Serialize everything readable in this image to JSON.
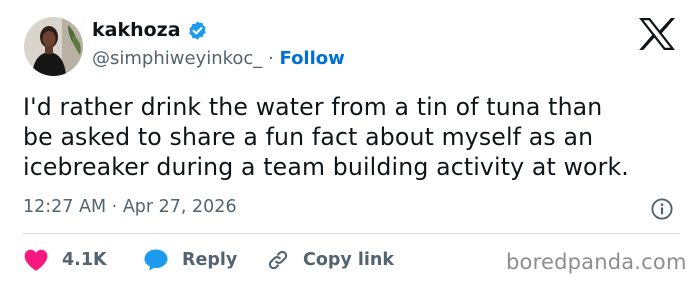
{
  "author": {
    "display_name": "kakhoza",
    "handle": "@simphiweyinkoc_",
    "separator": "·",
    "follow_label": "Follow",
    "verified": true
  },
  "tweet": {
    "lines": [
      "I'd rather drink the water from a tin of tuna than",
      "be asked to share a fun fact about myself as an",
      "icebreaker during a team building activity at work."
    ],
    "time": "12:27 AM",
    "date_separator": "·",
    "date": "Apr 27, 2026"
  },
  "actions": {
    "likes_count": "4.1K",
    "reply_label": "Reply",
    "copy_link_label": "Copy link"
  },
  "icons": {
    "platform": "x-logo-icon",
    "verified": "verified-badge-icon",
    "info": "info-icon",
    "like": "heart-icon",
    "reply": "speech-bubble-icon",
    "copy": "link-icon"
  },
  "colors": {
    "text": "#0f1419",
    "secondary": "#536471",
    "follow": "#006fd6",
    "verified": "#1d9bf0",
    "heart": "#f91880",
    "divider": "#cfd9de",
    "watermark": "#8e8e8e"
  },
  "watermark": "boredpanda.com"
}
